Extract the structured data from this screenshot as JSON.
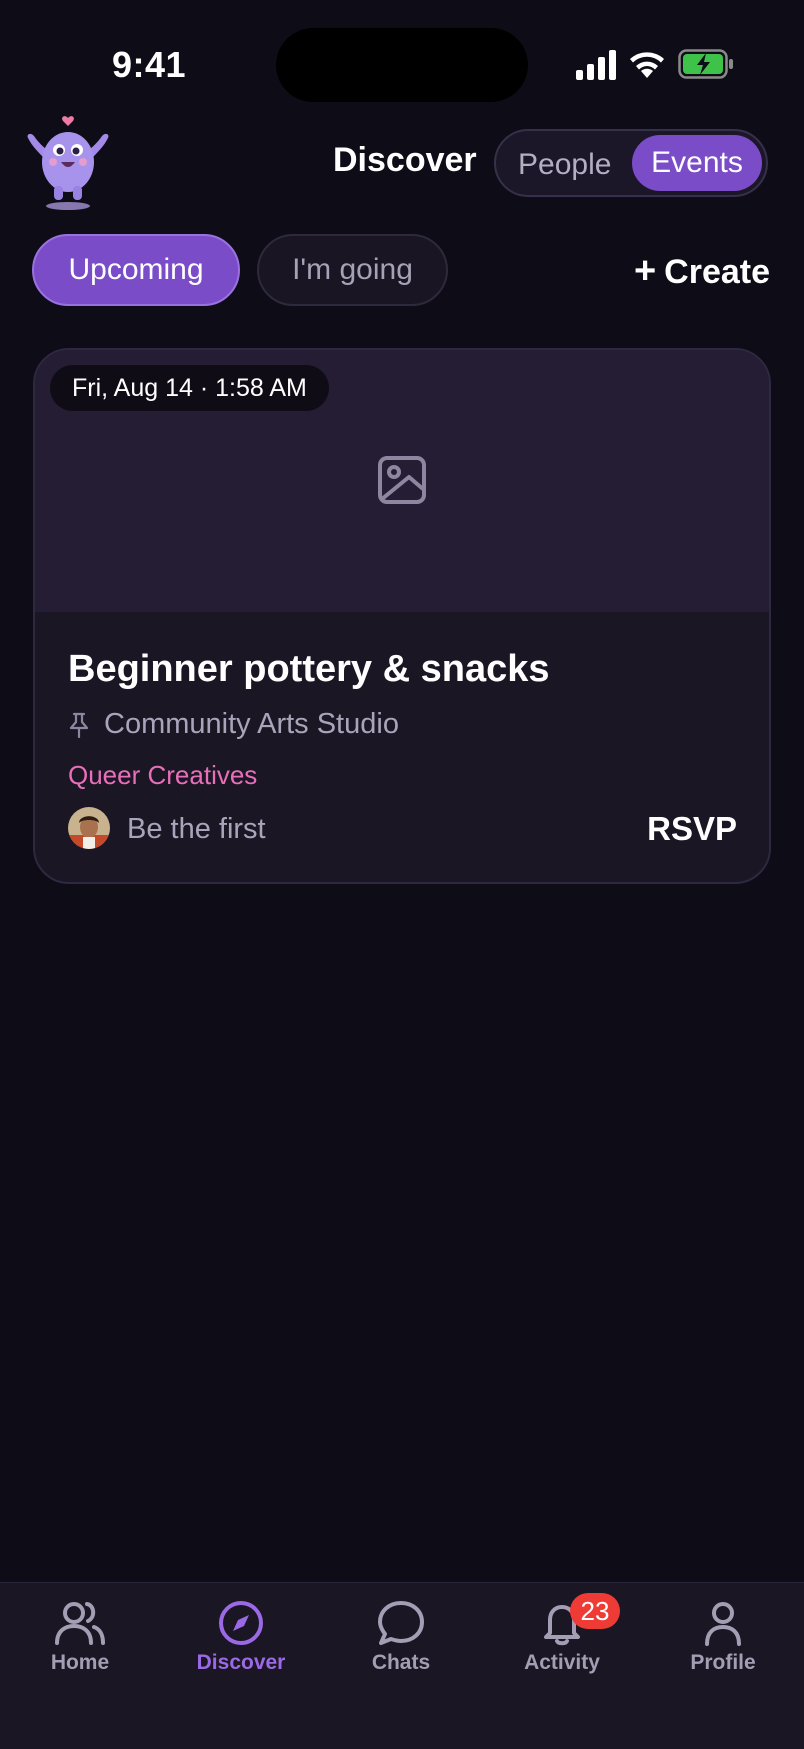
{
  "status_bar": {
    "time": "9:41",
    "battery_color": "#3ec24a"
  },
  "header": {
    "title": "Discover",
    "segments": [
      "People",
      "Events"
    ],
    "active_segment": "Events",
    "mascot_icon": "purple-mascot-with-heart"
  },
  "filters": {
    "upcoming_label": "Upcoming",
    "going_label": "I'm going",
    "active": "Upcoming",
    "create_label": "Create"
  },
  "event_card": {
    "date": "Fri, Aug 14 · 1:58 AM",
    "image_placeholder_icon": "image-icon",
    "title": "Beginner pottery & snacks",
    "location": "Community Arts Studio",
    "group": "Queer Creatives",
    "attendees_text": "Be the first",
    "rsvp_label": "RSVP"
  },
  "tabbar": {
    "tabs": [
      {
        "label": "Home",
        "icon": "people-icon"
      },
      {
        "label": "Discover",
        "icon": "compass-icon"
      },
      {
        "label": "Chats",
        "icon": "chat-bubble-icon"
      },
      {
        "label": "Activity",
        "icon": "bell-icon"
      },
      {
        "label": "Profile",
        "icon": "person-icon"
      }
    ],
    "active": "Discover",
    "activity_badge": "23"
  },
  "colors": {
    "background": "#0e0c16",
    "accent": "#7a4cc8",
    "group_pink": "#e76fb9",
    "badge_red": "#ef3b35"
  }
}
